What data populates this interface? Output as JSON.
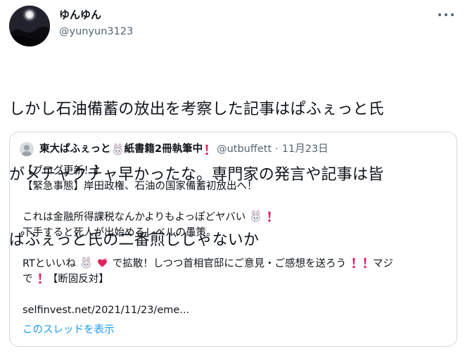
{
  "author": {
    "display_name": "ゆんゆん",
    "handle": "@yunyun3123"
  },
  "tweet": {
    "lines": [
      "しかし石油備蓄の放出を考察した記事はぱふぇっと氏",
      "がメチャクチャ早かったな。専門家の発言や記事は皆",
      "ぱふぇっと氏の二番煎じじゃないか"
    ]
  },
  "quote": {
    "name_part1": "東大ぱふぇっと",
    "name_part2": "紙書籍2冊執筆中",
    "handle": "@utbuffett",
    "dot": "·",
    "date": "11月23日",
    "line1": "【ブログ更新！】",
    "line2": "【緊急事態】岸田政権、石油の国家備蓄初放出へ！",
    "line3": "これは金融所得課税なんかよりもよっぽどヤバい",
    "line4": "下手すると死人が出始めるレベルの愚策。",
    "line5_a": "RTといいね",
    "line5_b": "で拡散！しつつ首相官邸にご意見・ご感想を送ろう",
    "line5_c": "マジ",
    "line6_a": "で",
    "line6_b": "【断固反対】",
    "link": "selfinvest.net/2021/11/23/eme...",
    "show_thread": "このスレッドを表示"
  },
  "colors": {
    "text": "#0f1419",
    "secondary": "#536471",
    "link": "#1d9bf0",
    "border": "#cfd9de",
    "exclamation": "#e0245e"
  },
  "icons": [
    "avatar-image",
    "more-options-icon",
    "rabbit-emoji",
    "red-exclamation-emoji",
    "heart-emoji"
  ]
}
